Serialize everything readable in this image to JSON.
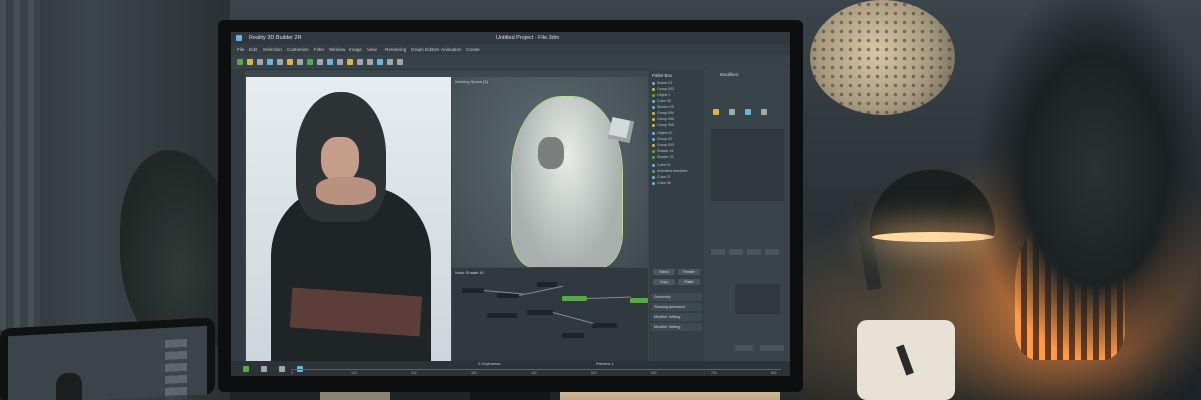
{
  "app": {
    "name": "Reality 3D Builder 2R",
    "document_title": "Untitled Project - File.3dm"
  },
  "menu": [
    {
      "label": "File"
    },
    {
      "label": "Edit"
    },
    {
      "label": "Selection"
    },
    {
      "label": "Customize"
    },
    {
      "label": "Filter"
    },
    {
      "label": "Window"
    },
    {
      "label": "Image"
    },
    {
      "label": "View"
    },
    {
      "label": "Rendering"
    },
    {
      "label": "Graph Editors"
    },
    {
      "label": "Animation"
    },
    {
      "label": "Create"
    }
  ],
  "viewport_label": "Working Space [3]",
  "node_editor_label": "Node Shader #1",
  "panels": {
    "properties_title": "Pallet Box",
    "modifiers_title": "Modifiers",
    "items": [
      "Scene 01",
      "Group 003",
      "Object 1",
      "Cube 03",
      "Sphere 05",
      "Group 004",
      "Group 005",
      "Group 006",
      "Object 02",
      "Group 02",
      "Group 003",
      "Shader 01",
      "Shader 02",
      "Cube 01",
      "Animated timelines",
      "Cube 07",
      "Cube 08"
    ],
    "sections": [
      "Geometry",
      "Shading Animated",
      "Modifier Setting",
      "Modifier Setting"
    ],
    "buttons": [
      "Select",
      "Render",
      "Copy",
      "Paste"
    ]
  },
  "playback": {
    "label": "2 Keyframes",
    "frame_label": "Preview 1"
  },
  "timeline_ticks": [
    "0",
    "100",
    "200",
    "300",
    "400",
    "500",
    "600",
    "700",
    "800"
  ],
  "colors": {
    "accent": "#6fb4d8",
    "node_green": "#5ea64b",
    "ui_dark": "#2f383d"
  }
}
